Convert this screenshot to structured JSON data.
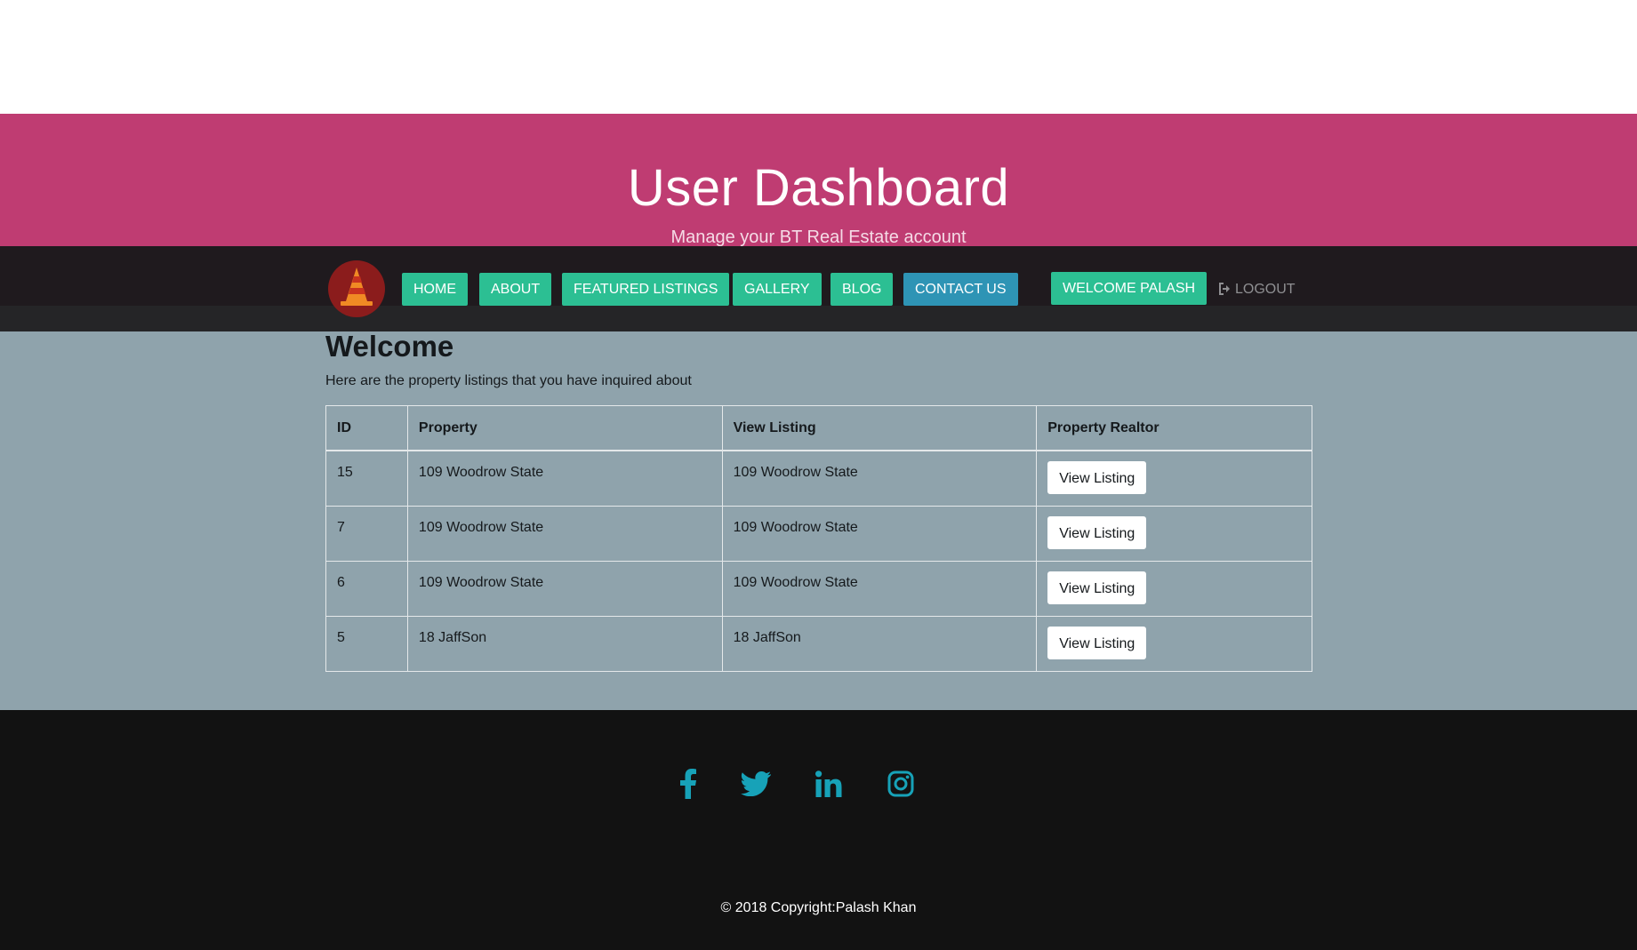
{
  "hero": {
    "title": "User Dashboard",
    "subtitle": "Manage your BT Real Estate account"
  },
  "nav": {
    "logo": "cone-logo-icon",
    "items": [
      {
        "label": "HOME"
      },
      {
        "label": "ABOUT"
      },
      {
        "label": "FEATURED LISTINGS"
      },
      {
        "label": "GALLERY"
      },
      {
        "label": "BLOG"
      },
      {
        "label": "CONTACT US"
      }
    ],
    "welcome_label": "WELCOME PALASH",
    "logout_label": "LOGOUT",
    "logout_icon": "sign-out-icon"
  },
  "main": {
    "heading": "Welcome",
    "intro": "Here are the property listings that you have inquired about",
    "table": {
      "headers": [
        "ID",
        "Property",
        "View Listing",
        "Property Realtor"
      ],
      "rows": [
        {
          "id": "15",
          "property": "109 Woodrow State",
          "listing": "109 Woodrow State",
          "action": "View Listing"
        },
        {
          "id": "7",
          "property": "109 Woodrow State",
          "listing": "109 Woodrow State",
          "action": "View Listing"
        },
        {
          "id": "6",
          "property": "109 Woodrow State",
          "listing": "109 Woodrow State",
          "action": "View Listing"
        },
        {
          "id": "5",
          "property": "18 JaffSon",
          "listing": "18 JaffSon",
          "action": "View Listing"
        }
      ]
    }
  },
  "footer": {
    "social": [
      "facebook-icon",
      "twitter-icon",
      "linkedin-icon",
      "instagram-icon"
    ],
    "copyright": "© 2018 Copyright:Palash Khan"
  },
  "colors": {
    "hero_bg": "#bf3c72",
    "nav_bg": "#1f1a1e",
    "nav_button": "#2cbf93",
    "contact_button": "#2e94b5",
    "main_bg": "#8fa3ac",
    "footer_bg": "#121212",
    "social_icon": "#17a2b8"
  }
}
